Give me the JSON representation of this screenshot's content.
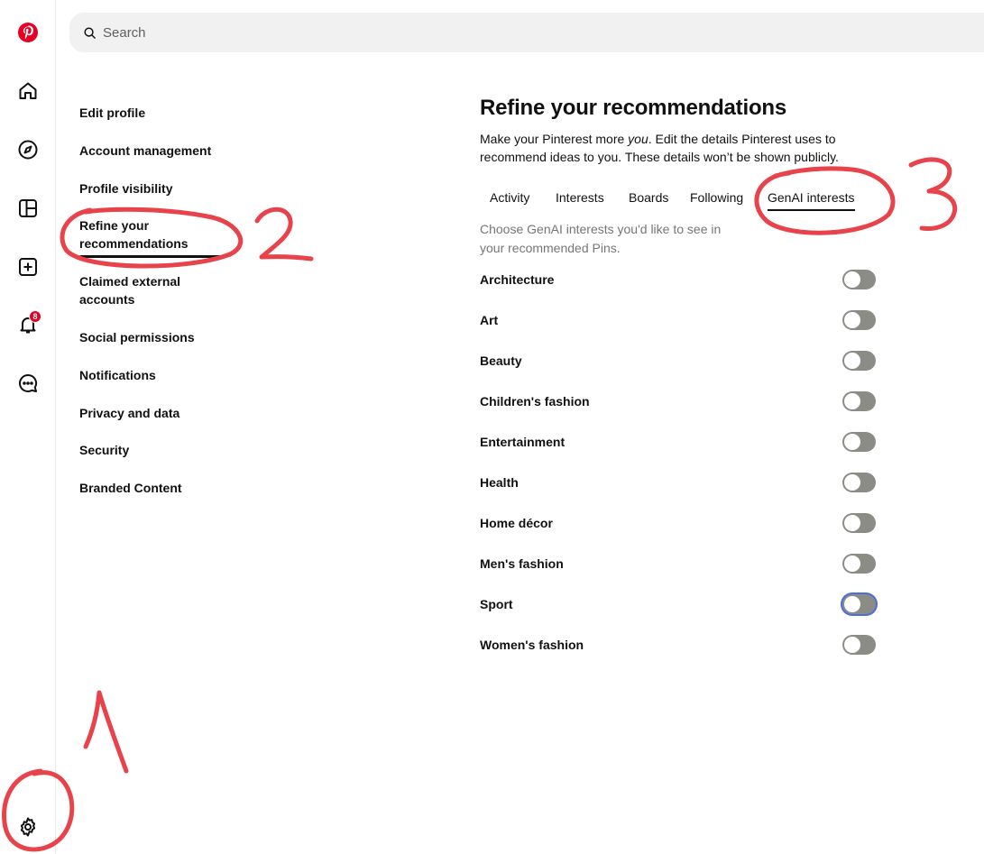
{
  "search": {
    "placeholder": "Search"
  },
  "rail": {
    "notifications_badge": "8"
  },
  "settings_nav": [
    {
      "label": "Edit profile"
    },
    {
      "label": "Account management"
    },
    {
      "label": "Profile visibility"
    },
    {
      "label": "Refine your recommendations"
    },
    {
      "label": "Claimed external accounts"
    },
    {
      "label": "Social permissions"
    },
    {
      "label": "Notifications"
    },
    {
      "label": "Privacy and data"
    },
    {
      "label": "Security"
    },
    {
      "label": "Branded Content"
    }
  ],
  "main": {
    "title": "Refine your recommendations",
    "desc_before": "Make your Pinterest more ",
    "desc_em": "you",
    "desc_after": ". Edit the details Pinterest uses to recommend ideas to you. These details won’t be shown publicly.",
    "tabs": [
      {
        "label": "Activity"
      },
      {
        "label": "Interests"
      },
      {
        "label": "Boards"
      },
      {
        "label": "Following"
      },
      {
        "label": "GenAI interests",
        "active": true
      }
    ],
    "helper": "Choose GenAI interests you'd like to see in your recommended Pins.",
    "interests": [
      {
        "label": "Architecture",
        "on": false
      },
      {
        "label": "Art",
        "on": false
      },
      {
        "label": "Beauty",
        "on": false
      },
      {
        "label": "Children's fashion",
        "on": false
      },
      {
        "label": "Entertainment",
        "on": false
      },
      {
        "label": "Health",
        "on": false
      },
      {
        "label": "Home décor",
        "on": false
      },
      {
        "label": "Men's fashion",
        "on": false
      },
      {
        "label": "Sport",
        "on": false
      },
      {
        "label": "Women's fashion",
        "on": false
      }
    ]
  },
  "annotations": {
    "one": "1",
    "two": "2",
    "three": "3"
  },
  "colors": {
    "brand": "#e60023",
    "toggle_off": "#8c8c86",
    "annotation": "#e8424a"
  }
}
